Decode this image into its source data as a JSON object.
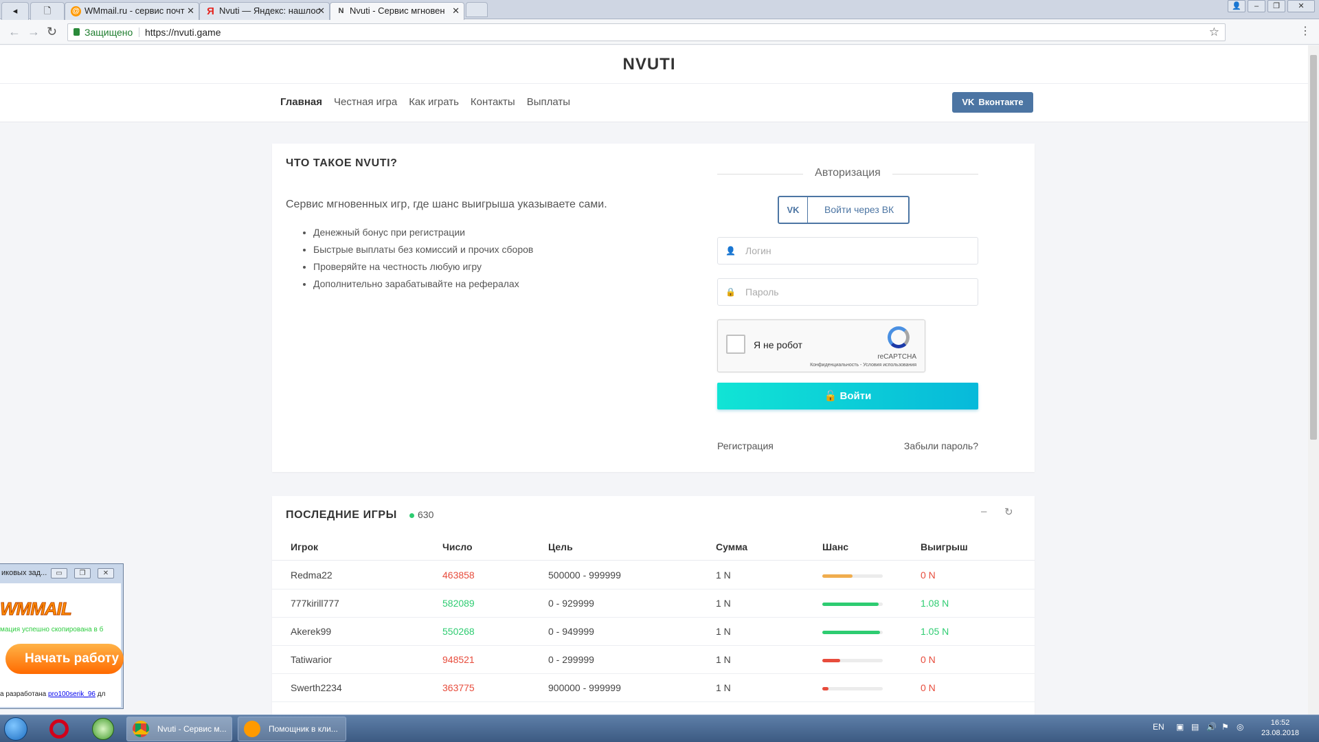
{
  "browser": {
    "tabs": [
      {
        "label": "WMmail.ru - сервис почт"
      },
      {
        "label": "Nvuti — Яндекс: нашлос"
      },
      {
        "label": "Nvuti - Сервис мгновен"
      }
    ],
    "secure_label": "Защищено",
    "url": "https://nvuti.game"
  },
  "site": {
    "logo": "NVUTI",
    "nav": [
      "Главная",
      "Честная игра",
      "Как играть",
      "Контакты",
      "Выплаты"
    ],
    "vk_button": "Вконтакте"
  },
  "about": {
    "title": "ЧТО ТАКОЕ NVUTI?",
    "lead": "Сервис мгновенных игр, где шанс выигрыша указываете сами.",
    "bullets": [
      "Денежный бонус при регистрации",
      "Быстрые выплаты без комиссий и прочих сборов",
      "Проверяйте на честность любую игру",
      "Дополнительно зарабатывайте на рефералах"
    ]
  },
  "auth": {
    "title": "Авторизация",
    "vk_login": "Войти через ВК",
    "login_placeholder": "Логин",
    "password_placeholder": "Пароль",
    "captcha_label": "Я не робот",
    "captcha_brand": "reCAPTCHA",
    "captcha_terms": "Конфиденциальность - Условия использования",
    "submit": "Войти",
    "register": "Регистрация",
    "forgot": "Забыли пароль?"
  },
  "games": {
    "title": "ПОСЛЕДНИЕ ИГРЫ",
    "online": "630",
    "columns": [
      "Игрок",
      "Число",
      "Цель",
      "Сумма",
      "Шанс",
      "Выигрыш"
    ],
    "rows": [
      {
        "player": "Redma22",
        "number": "463858",
        "number_win": false,
        "target": "500000 - 999999",
        "sum": "1 N",
        "chance": 0.5,
        "chance_color": "#f0ad4e",
        "payout": "0 N",
        "win": false
      },
      {
        "player": "777kirill777",
        "number": "582089",
        "number_win": true,
        "target": "0 - 929999",
        "sum": "1 N",
        "chance": 0.93,
        "chance_color": "#2ecc71",
        "payout": "1.08 N",
        "win": true
      },
      {
        "player": "Akerek99",
        "number": "550268",
        "number_win": true,
        "target": "0 - 949999",
        "sum": "1 N",
        "chance": 0.95,
        "chance_color": "#2ecc71",
        "payout": "1.05 N",
        "win": true
      },
      {
        "player": "Tatiwarior",
        "number": "948521",
        "number_win": false,
        "target": "0 - 299999",
        "sum": "1 N",
        "chance": 0.3,
        "chance_color": "#e74c3c",
        "payout": "0 N",
        "win": false
      },
      {
        "player": "Swerth2234",
        "number": "363775",
        "number_win": false,
        "target": "900000 - 999999",
        "sum": "1 N",
        "chance": 0.1,
        "chance_color": "#e74c3c",
        "payout": "0 N",
        "win": false
      }
    ]
  },
  "wmmail_window": {
    "title": "иковых зад...",
    "logo": "WMMAIL",
    "copied": "мация успешно скопирована в б",
    "start": "Начать работу",
    "footer_prefix": "а разработана",
    "footer_link": "pro100serik_96",
    "footer_suffix": "дл"
  },
  "taskbar": {
    "items": [
      {
        "label": "Nvuti - Сервис м..."
      },
      {
        "label": "Помощник в кли..."
      }
    ],
    "lang": "EN",
    "time": "16:52",
    "date": "23.08.2018"
  }
}
